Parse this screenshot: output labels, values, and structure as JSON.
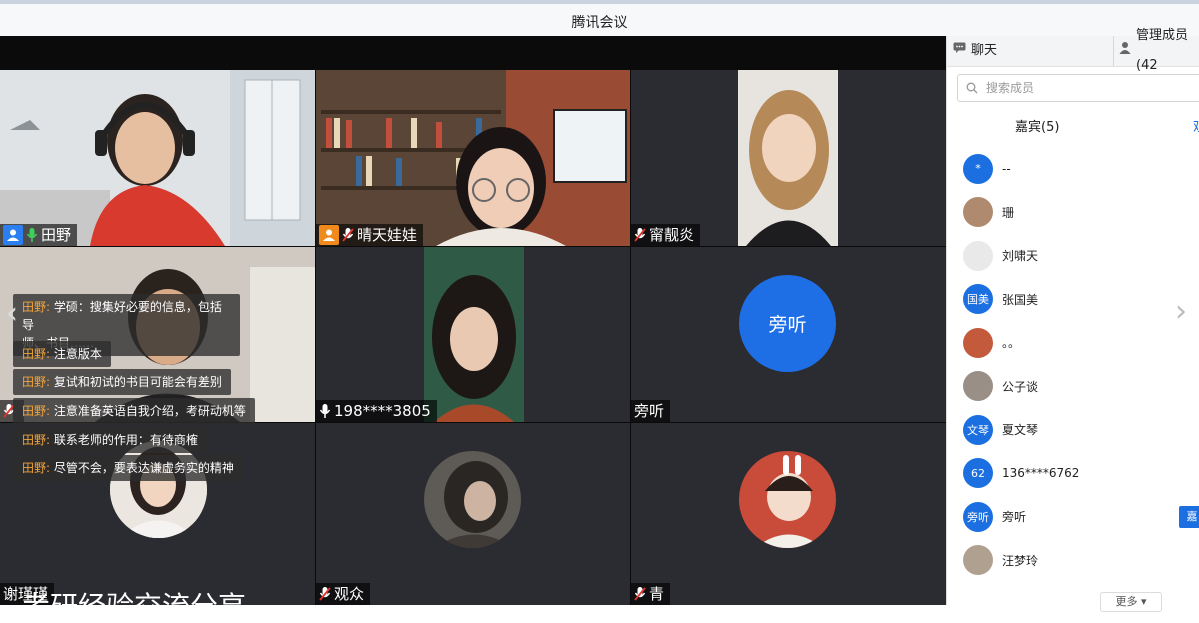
{
  "window": {
    "title": "腾讯会议"
  },
  "tiles": [
    {
      "name": "田野",
      "host": true,
      "host_color": "#2b7ff0",
      "mic": "on"
    },
    {
      "name": "晴天娃娃",
      "host": true,
      "host_color": "#f08a1c",
      "mic": "muted"
    },
    {
      "name": "甯靓炎",
      "mic": "muted"
    },
    {
      "name": "",
      "mic": "muted"
    },
    {
      "name": "198****3805",
      "mic": "on"
    },
    {
      "name": "旁听",
      "avatar_text": "旁听"
    },
    {
      "name": "谢瑾瑾"
    },
    {
      "name": "观众",
      "mic": "muted"
    },
    {
      "name": "青",
      "mic": "muted"
    }
  ],
  "chat_overlay": [
    {
      "who": "田野:",
      "text": "学硕：搜集好必要的信息，包括导",
      "text2": "师、书目……"
    },
    {
      "who": "田野:",
      "text": "注意版本"
    },
    {
      "who": "田野:",
      "text": "复试和初试的书目可能会有差别"
    },
    {
      "who": "田野:",
      "text": "注意准备英语自我介绍，考研动机等"
    },
    {
      "who": "田野:",
      "text": "联系老师的作用：有待商榷"
    },
    {
      "who": "田野:",
      "text": "尽管不会，要表达谦虚务实的精神"
    }
  ],
  "bottom_caption": "考研经验交流分享",
  "sidebar": {
    "tab_chat": "聊天",
    "tab_members": "管理成员(42",
    "search_placeholder": "搜索成员",
    "subtab_guests": "嘉宾(5)",
    "subtab_other": "观",
    "members": [
      {
        "name": "--",
        "avatar_text": "*",
        "color": "#1b6fe0"
      },
      {
        "name": "珊",
        "avatar_text": "",
        "color": "#b08a6e"
      },
      {
        "name": "刘啸天",
        "avatar_text": "",
        "color": "#e9e9e9"
      },
      {
        "name": "张国美",
        "avatar_text": "国美",
        "color": "#1b6fe0"
      },
      {
        "name": "。。",
        "avatar_text": "",
        "color": "#c25a3b"
      },
      {
        "name": "公子谈",
        "avatar_text": "",
        "color": "#9a8f86"
      },
      {
        "name": "夏文琴",
        "avatar_text": "文琴",
        "color": "#1b6fe0"
      },
      {
        "name": "136****6762",
        "avatar_text": "62",
        "color": "#1b6fe0"
      },
      {
        "name": "旁听",
        "avatar_text": "旁听",
        "color": "#1b6fe0",
        "button": "嘉"
      },
      {
        "name": "汪梦玲",
        "avatar_text": "",
        "color": "#b0a090"
      }
    ],
    "more_label": "更多 ▾"
  },
  "colors": {
    "accent": "#1b6fe0",
    "host_orange": "#f08a1c",
    "chat_name": "#f2a43a"
  }
}
